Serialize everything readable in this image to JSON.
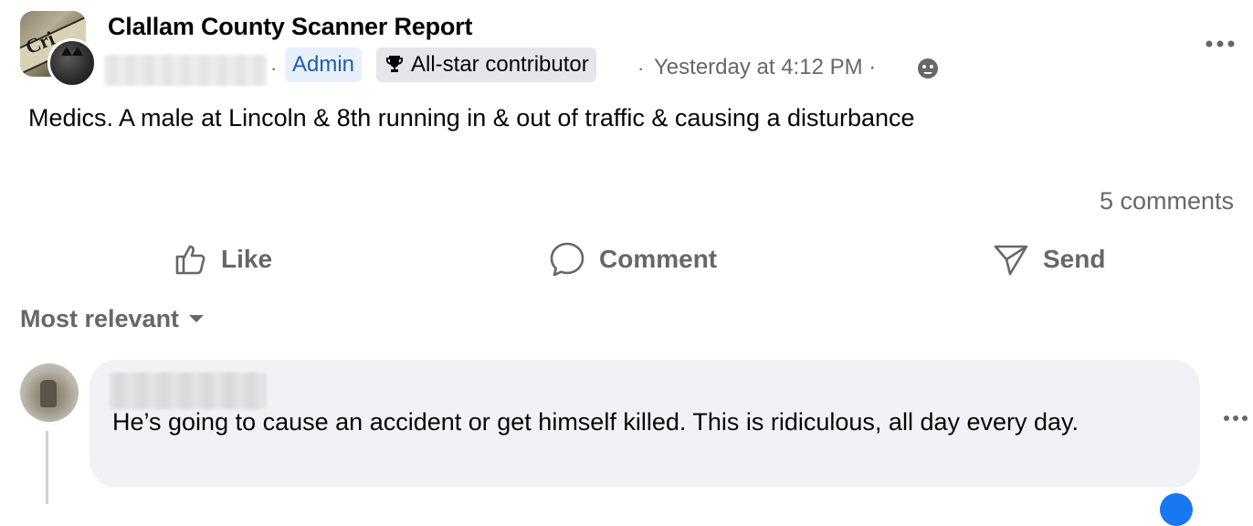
{
  "post": {
    "group_name": "Clallam County Scanner Report",
    "separator": "·",
    "badges": {
      "admin": "Admin",
      "contributor": "All-star contributor"
    },
    "timestamp": "Yesterday at 4:12 PM",
    "timestamp_sep": "·",
    "privacy_icon": "globe-icon",
    "text": "Medics. A male at Lincoln & 8th running in & out of traffic & causing a disturbance",
    "comments_count": "5 comments"
  },
  "actions": {
    "like": "Like",
    "comment": "Comment",
    "send": "Send"
  },
  "comments_section": {
    "sort_label": "Most relevant",
    "comments": [
      {
        "text": "He’s going to cause an accident or get himself killed. This is ridiculous, all day every day."
      }
    ]
  },
  "colors": {
    "admin_badge_bg": "#e7f0fb",
    "admin_badge_text": "#1d5fb0",
    "muted": "#65676b",
    "bubble": "#f0f2f5",
    "accent": "#1877f2"
  }
}
